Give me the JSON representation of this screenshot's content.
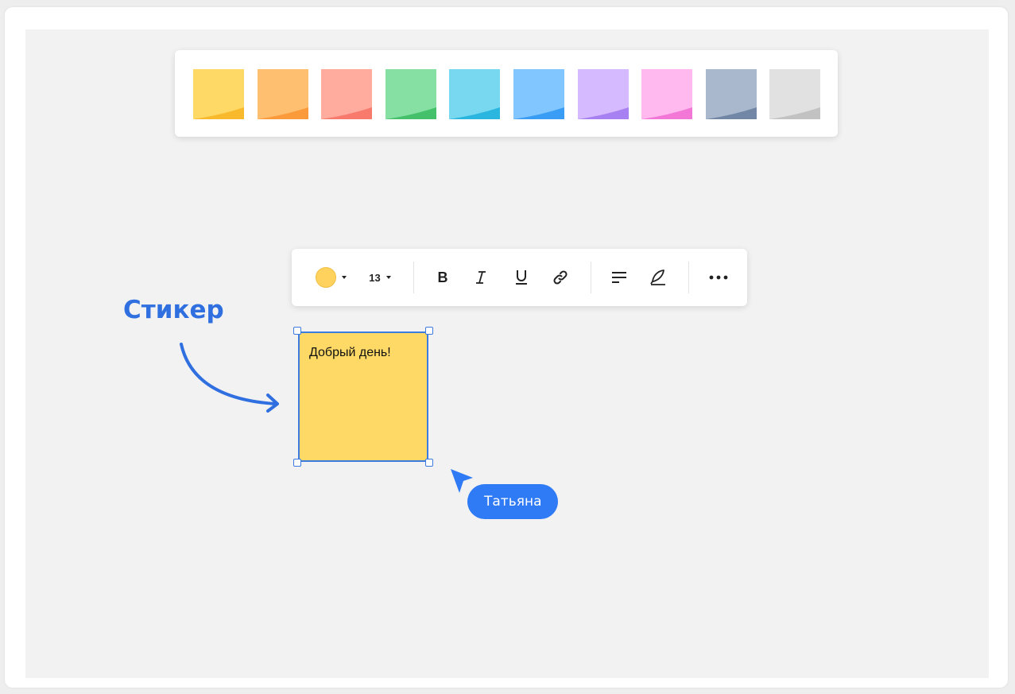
{
  "palette": {
    "swatches": [
      {
        "name": "yellow",
        "color": "#ffd966",
        "edge": "#f9b92d"
      },
      {
        "name": "orange",
        "color": "#ffbf70",
        "edge": "#fb9a3a"
      },
      {
        "name": "coral",
        "color": "#ffab9e",
        "edge": "#f77a6c"
      },
      {
        "name": "green",
        "color": "#86e0a3",
        "edge": "#45c06b"
      },
      {
        "name": "cyan",
        "color": "#78d8f0",
        "edge": "#2bb6df"
      },
      {
        "name": "blue",
        "color": "#82c6ff",
        "edge": "#3a9df5"
      },
      {
        "name": "lavender",
        "color": "#d5baff",
        "edge": "#a781f2"
      },
      {
        "name": "pink",
        "color": "#ffb9ef",
        "edge": "#f377d6"
      },
      {
        "name": "slate",
        "color": "#a9b8cc",
        "edge": "#7286a6"
      },
      {
        "name": "gray",
        "color": "#e1e1e1",
        "edge": "#c2c2c2"
      }
    ]
  },
  "toolbar": {
    "color": "#ffd25e",
    "font_size": "13",
    "bold_label": "B",
    "icons": [
      "color-picker-icon",
      "bold-icon",
      "italic-icon",
      "underline-icon",
      "link-icon",
      "align-icon",
      "pen-icon",
      "more-icon"
    ]
  },
  "annotation": {
    "label": "Стикер",
    "color": "#2f6fe0"
  },
  "sticker": {
    "text": "Добрый день!",
    "color": "#ffd966",
    "selection_color": "#3d7be0"
  },
  "collaborator": {
    "name": "Татьяна",
    "color": "#2f7af5"
  }
}
